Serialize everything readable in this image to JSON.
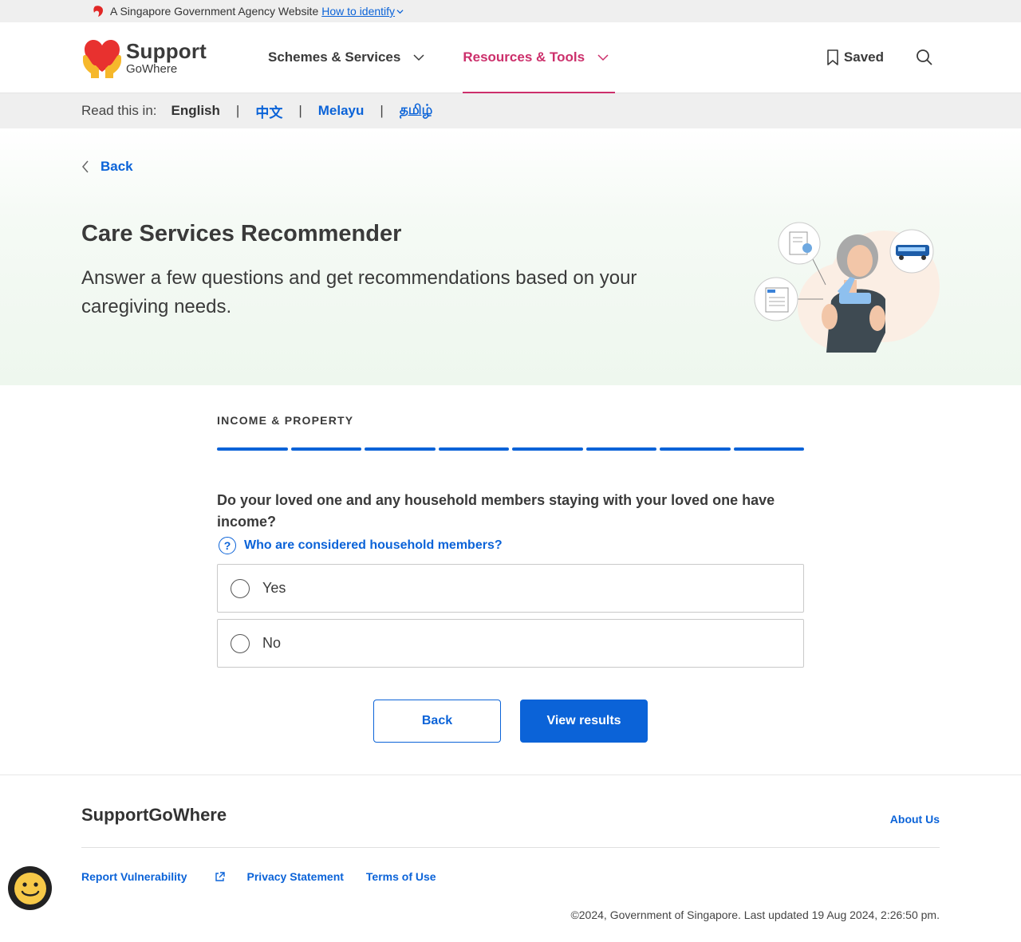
{
  "masthead": {
    "text": "A Singapore Government Agency Website",
    "link": "How to identify"
  },
  "header": {
    "logo_main": "Support",
    "logo_sub": "GoWhere",
    "nav": [
      {
        "label": "Schemes & Services",
        "active": false
      },
      {
        "label": "Resources & Tools",
        "active": true
      }
    ],
    "saved_label": "Saved"
  },
  "language": {
    "label": "Read this in:",
    "current": "English",
    "options": [
      "中文",
      "Melayu",
      "தமிழ்"
    ]
  },
  "hero": {
    "back_label": "Back",
    "title": "Care Services Recommender",
    "subtitle": "Answer a few questions and get recommendations based on your caregiving needs."
  },
  "question": {
    "section_label": "INCOME & PROPERTY",
    "progress": {
      "completed": 8,
      "total": 8
    },
    "text": "Do your loved one and any household members staying with your loved one have income?",
    "help_link": "Who are considered household members?",
    "help_icon_glyph": "?",
    "options": [
      {
        "label": "Yes",
        "selected": false
      },
      {
        "label": "No",
        "selected": false
      }
    ],
    "back_button": "Back",
    "view_button": "View results"
  },
  "footer": {
    "brand": "SupportGoWhere",
    "about": "About Us",
    "links": [
      "Report Vulnerability",
      "Privacy Statement",
      "Terms of Use"
    ],
    "copyright": "©2024, Government of Singapore. Last updated 19 Aug 2024, 2:26:50 pm."
  },
  "colors": {
    "primary": "#0b63d8",
    "active_nav": "#cc2f6b",
    "logo_heart": "#e8312f",
    "logo_hands": "#f6b82b"
  },
  "icons": [
    "lion-head-icon",
    "chevron-down-icon",
    "bookmark-icon",
    "search-icon",
    "chevron-left-icon",
    "question-circle-icon",
    "external-link-icon",
    "smiley-icon"
  ]
}
